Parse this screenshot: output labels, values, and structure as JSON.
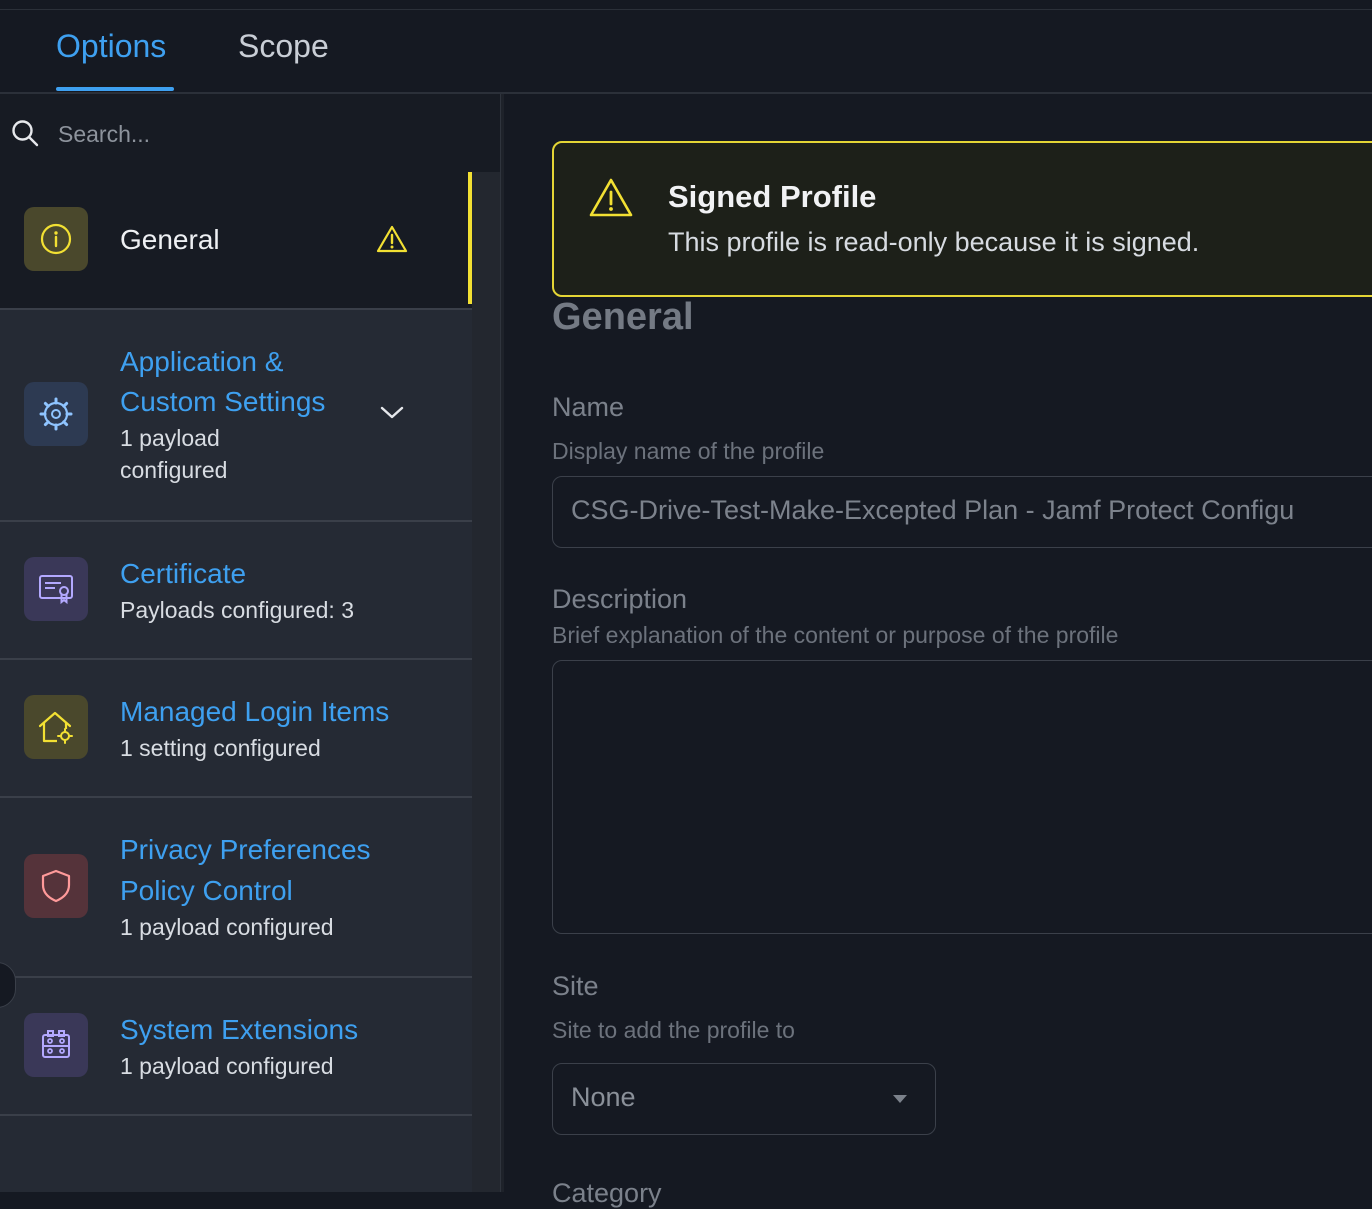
{
  "tabs": [
    {
      "label": "Options",
      "active": true
    },
    {
      "label": "Scope",
      "active": false
    }
  ],
  "search": {
    "placeholder": "Search..."
  },
  "sidebar": {
    "items": [
      {
        "title": "General",
        "subtitle": "",
        "icon": "info-icon",
        "status_icon": "warning-icon",
        "selected": true
      },
      {
        "title_lines": [
          "Application &",
          "Custom Settings"
        ],
        "subtitle_lines": [
          "1 payload",
          "configured"
        ],
        "icon": "gear-icon",
        "expand_icon": "chevron-down-icon"
      },
      {
        "title": "Certificate",
        "subtitle": "Payloads configured: 3",
        "icon": "certificate-icon"
      },
      {
        "title": "Managed Login Items",
        "subtitle": "1 setting configured",
        "icon": "home-gear-icon"
      },
      {
        "title_lines": [
          "Privacy Preferences",
          "Policy Control"
        ],
        "subtitle": "1 payload configured",
        "icon": "shield-icon"
      },
      {
        "title": "System Extensions",
        "subtitle": "1 payload configured",
        "icon": "extension-icon"
      }
    ]
  },
  "alert": {
    "title": "Signed Profile",
    "body": "This profile is read-only because it is signed.",
    "icon": "warning-icon"
  },
  "form": {
    "heading": "General",
    "name_label": "Name",
    "name_hint": "Display name of the profile",
    "name_value": "CSG-Drive-Test-Make-Excepted Plan - Jamf Protect Configu",
    "description_label": "Description",
    "description_hint": "Brief explanation of the content or purpose of the profile",
    "description_value": "",
    "site_label": "Site",
    "site_hint": "Site to add the profile to",
    "site_value": "None",
    "category_label": "Category"
  },
  "colors": {
    "accent": "#3ea0f0",
    "warning": "#f2e033",
    "background": "#151922",
    "sidebar": "#252a34"
  }
}
